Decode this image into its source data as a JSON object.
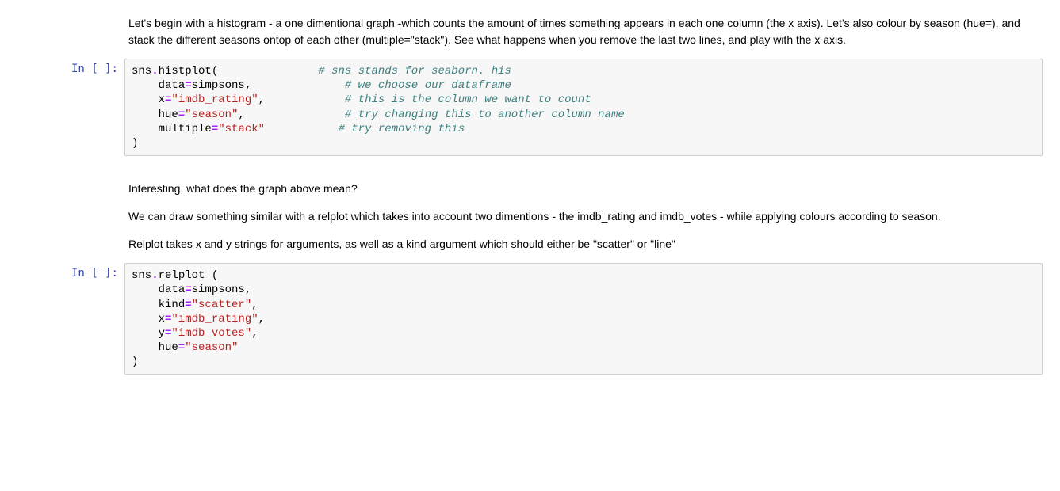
{
  "prompts": {
    "in_empty": "In [ ]:"
  },
  "md1": {
    "p1": "Let's begin with a histogram - a one dimentional graph -which counts the amount of times something appears in each one column (the x axis). Let's also colour by season (hue=), and stack the different seasons ontop of each other (multiple=\"stack\"). See what happens when you remove the last two lines, and play with the x axis."
  },
  "code1": {
    "l1_a": "sns",
    "l1_b": ".",
    "l1_c": "histplot",
    "l1_d": "(",
    "l1_pad": "               ",
    "l1_cm": "# sns stands for seaborn. his",
    "l2_indent": "    ",
    "l2_a": "data",
    "l2_b": "=",
    "l2_c": "simpsons",
    "l2_d": ",",
    "l2_pad": "              ",
    "l2_cm": "# we choose our dataframe",
    "l3_indent": "    ",
    "l3_a": "x",
    "l3_b": "=",
    "l3_c": "\"imdb_rating\"",
    "l3_d": ",",
    "l3_pad": "            ",
    "l3_cm": "# this is the column we want to count",
    "l4_indent": "    ",
    "l4_a": "hue",
    "l4_b": "=",
    "l4_c": "\"season\"",
    "l4_d": ",",
    "l4_pad": "               ",
    "l4_cm": "# try changing this to another column name",
    "l5_indent": "    ",
    "l5_a": "multiple",
    "l5_b": "=",
    "l5_c": "\"stack\"",
    "l5_pad": "           ",
    "l5_cm": "# try removing this",
    "l6": ")"
  },
  "md2": {
    "p1": "Interesting, what does the graph above mean?",
    "p2": "We can draw something similar with a relplot which takes into account two dimentions - the imdb_rating and imdb_votes - while applying colours according to season.",
    "p3": "Relplot takes x and y strings for arguments, as well as a kind argument which should either be \"scatter\" or \"line\""
  },
  "code2": {
    "l1_a": "sns",
    "l1_b": ".",
    "l1_c": "relplot ",
    "l1_d": "(",
    "l2_indent": "    ",
    "l2_a": "data",
    "l2_b": "=",
    "l2_c": "simpsons",
    "l2_d": ",",
    "l3_indent": "    ",
    "l3_a": "kind",
    "l3_b": "=",
    "l3_c": "\"scatter\"",
    "l3_d": ",",
    "l4_indent": "    ",
    "l4_a": "x",
    "l4_b": "=",
    "l4_c": "\"imdb_rating\"",
    "l4_d": ",",
    "l5_indent": "    ",
    "l5_a": "y",
    "l5_b": "=",
    "l5_c": "\"imdb_votes\"",
    "l5_d": ",",
    "l6_indent": "    ",
    "l6_a": "hue",
    "l6_b": "=",
    "l6_c": "\"season\"",
    "l7": ")"
  }
}
